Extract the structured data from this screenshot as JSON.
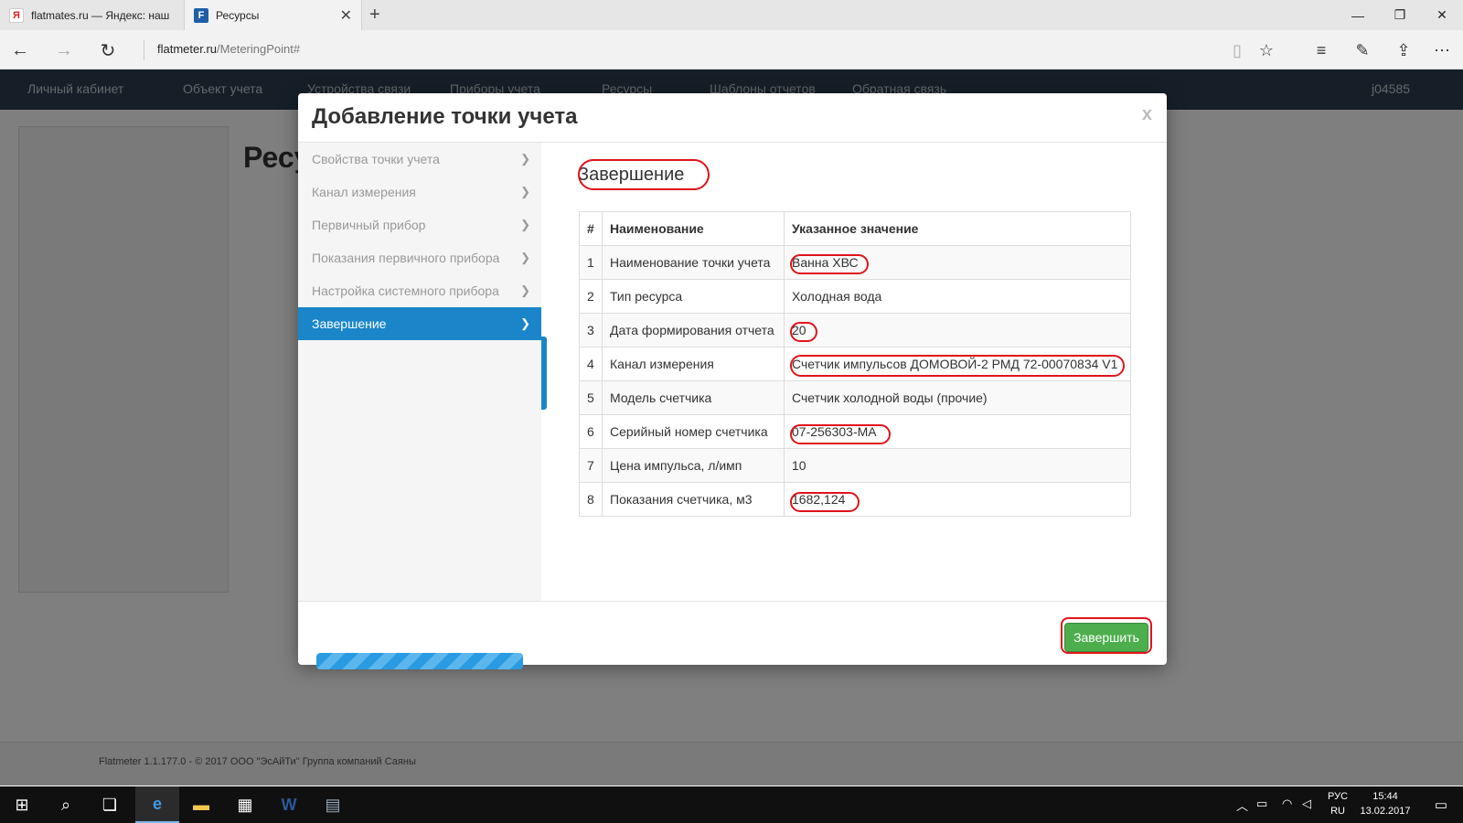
{
  "browser": {
    "tabs": [
      {
        "title": "flatmates.ru — Яндекс: наш",
        "favicon": "Я"
      },
      {
        "title": "Ресурсы",
        "favicon": "F"
      }
    ],
    "url_domain": "flatmeter.ru",
    "url_path": "/MeteringPoint#"
  },
  "site": {
    "nav": [
      "Личный кабинет",
      "Объект учета",
      "Устройства связи",
      "Приборы учета",
      "Ресурсы",
      "Шаблоны отчетов",
      "Обратная связь"
    ],
    "user": "j04585",
    "page_title": "Ресу",
    "footer": "Flatmeter 1.1.177.0 - © 2017 ООО \"ЭсАйТи\" Группа компаний Саяны"
  },
  "modal": {
    "title": "Добавление точки учета",
    "close": "x",
    "steps": [
      {
        "label": "Свойства точки учета",
        "active": false
      },
      {
        "label": "Канал измерения",
        "active": false
      },
      {
        "label": "Первичный прибор",
        "active": false
      },
      {
        "label": "Показания первичного прибора",
        "active": false
      },
      {
        "label": "Настройка системного прибора",
        "active": false
      },
      {
        "label": "Завершение",
        "active": true
      }
    ],
    "progress": 1.0,
    "content_title": "Завершение",
    "table": {
      "headers": [
        "#",
        "Наименование",
        "Указанное значение"
      ],
      "rows": [
        {
          "num": "1",
          "name": "Наименование точки учета",
          "value": "Ванна ХВС",
          "highlight": true
        },
        {
          "num": "2",
          "name": "Тип ресурса",
          "value": "Холодная вода",
          "highlight": false
        },
        {
          "num": "3",
          "name": "Дата формирования отчета",
          "value": "20",
          "highlight": true
        },
        {
          "num": "4",
          "name": "Канал измерения",
          "value": "Счетчик импульсов ДОМОВОЙ-2 РМД 72-00070834 V1",
          "highlight": true
        },
        {
          "num": "5",
          "name": "Модель счетчика",
          "value": "Счетчик холодной воды (прочие)",
          "highlight": false
        },
        {
          "num": "6",
          "name": "Серийный номер счетчика",
          "value": "07-256303-MA",
          "highlight": true
        },
        {
          "num": "7",
          "name": "Цена импульса, л/имп",
          "value": "10",
          "highlight": false
        },
        {
          "num": "8",
          "name": "Показания счетчика, м3",
          "value": "1682,124",
          "highlight": true
        }
      ]
    },
    "finish_label": "Завершить"
  },
  "taskbar": {
    "lang_top": "РУС",
    "lang_bottom": "RU",
    "time": "15:44",
    "date": "13.02.2017"
  },
  "colors": {
    "accent": "#1a86c9",
    "success": "#4cae4c",
    "annotation": "#e0141a",
    "nav_bg": "#2c3e50"
  }
}
